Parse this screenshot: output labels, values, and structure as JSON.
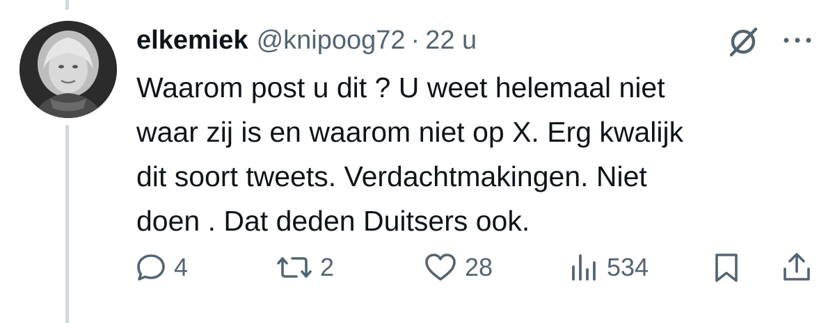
{
  "tweet": {
    "display_name": "elkemiek",
    "handle": "@knipoog72",
    "separator": "·",
    "time": "22 u",
    "text": "Waarom post u dit ? U weet helemaal niet\nwaar zij is en waarom niet op X. Erg kwalijk\ndit soort tweets. Verdachtmakingen. Niet\ndoen . Dat deden Duitsers ook."
  },
  "actions": {
    "replies": "4",
    "reposts": "2",
    "likes": "28",
    "views": "534"
  },
  "icons": {
    "grok": "grok-icon",
    "more": "more-icon",
    "reply": "reply-icon",
    "repost": "repost-icon",
    "like": "heart-icon",
    "views": "views-icon",
    "bookmark": "bookmark-icon",
    "share": "share-icon"
  },
  "colors": {
    "text": "#0f1419",
    "secondary": "#536471",
    "thread_line": "#cfd9de"
  }
}
